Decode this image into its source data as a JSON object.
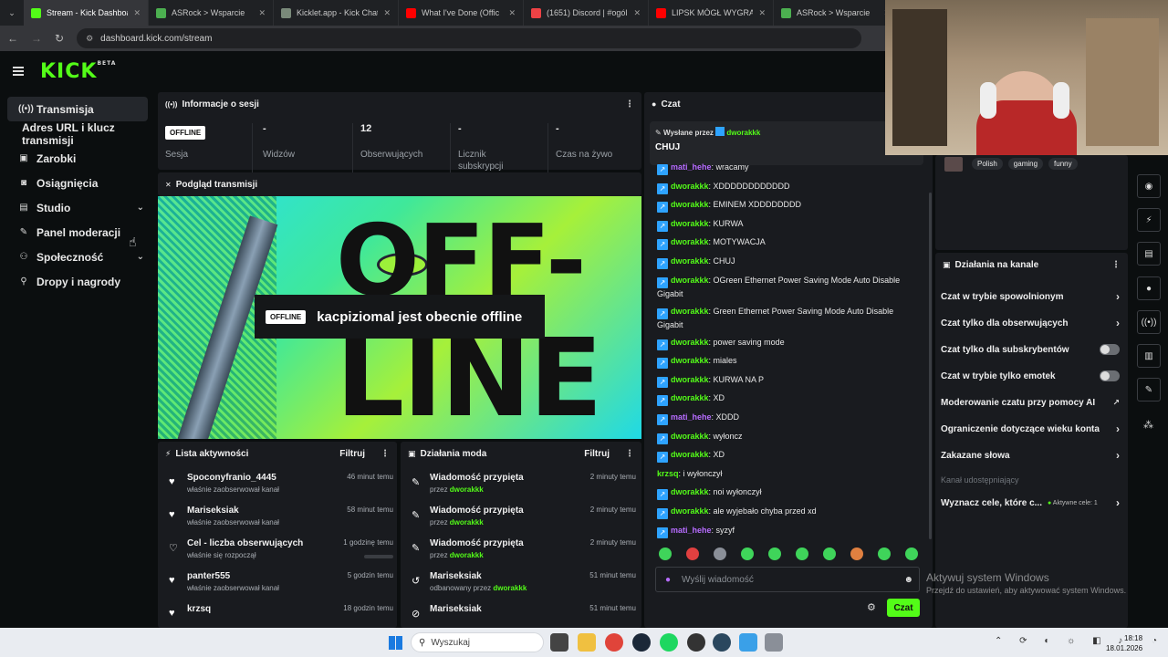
{
  "browser": {
    "tabs": [
      {
        "title": "Stream - Kick Dashboard",
        "color": "#53fc18",
        "active": true
      },
      {
        "title": "ASRock > Wsparcie",
        "color": "#4caf50"
      },
      {
        "title": "Kicklet.app - Kick Chatbot",
        "color": "#7a8a7a"
      },
      {
        "title": "What I've Done (Offic",
        "color": "#ff0000"
      },
      {
        "title": "(1651) Discord | #ogólny",
        "color": "#ed4245"
      },
      {
        "title": "LIPSK MÓGŁ WYGRAĆ, A",
        "color": "#ff0000"
      },
      {
        "title": "ASRock > Wsparcie",
        "color": "#4caf50"
      }
    ],
    "url": "dashboard.kick.com/stream"
  },
  "header": {
    "logo": "KICK",
    "beta": "BETA"
  },
  "sidebar": {
    "items": [
      {
        "label": "Transmisja",
        "icon": "broadcast-icon"
      },
      {
        "label": "Adres URL i klucz transmisji",
        "icon": ""
      },
      {
        "label": "Zarobki",
        "icon": "wallet-icon"
      },
      {
        "label": "Osiągnięcia",
        "icon": "trophy-icon"
      },
      {
        "label": "Studio",
        "icon": "studio-icon"
      },
      {
        "label": "Panel moderacji",
        "icon": "wrench-icon"
      },
      {
        "label": "Społeczność",
        "icon": "people-icon"
      },
      {
        "label": "Dropy i nagrody",
        "icon": "gift-icon"
      }
    ]
  },
  "session": {
    "title": "Informacje o sesji",
    "status": "OFFLINE",
    "status_label": "Sesja",
    "stats": [
      {
        "value": "-",
        "label": "Widzów"
      },
      {
        "value": "12",
        "label": "Obserwujących"
      },
      {
        "value": "-",
        "label": "Licznik subskrypcji"
      },
      {
        "value": "-",
        "label": "Czas na żywo"
      }
    ]
  },
  "preview": {
    "title": "Podgląd transmisji",
    "badge": "OFFLINE",
    "message": "kacpiziomal jest obecnie offline",
    "bg_text_1": "OFF-",
    "bg_text_2": "LINE"
  },
  "activity": {
    "title": "Lista aktywności",
    "filter": "Filtruj",
    "rows": [
      {
        "name": "Spoconyfranio_4445",
        "sub": "właśnie zaobserwował kanał",
        "time": "46 minut temu"
      },
      {
        "name": "Mariseksiak",
        "sub": "właśnie zaobserwował kanał",
        "time": "58 minut temu"
      },
      {
        "name": "Cel - liczba obserwujących",
        "sub": "właśnie się rozpoczął",
        "time": "1 godzinę temu"
      },
      {
        "name": "panter555",
        "sub": "właśnie zaobserwował kanał",
        "time": "5 godzin temu"
      },
      {
        "name": "krzsq",
        "sub": "",
        "time": "18 godzin temu"
      }
    ]
  },
  "modactions": {
    "title": "Działania moda",
    "filter": "Filtruj",
    "rows": [
      {
        "name": "Wiadomość przypięta",
        "sub_prefix": "przez",
        "by": "dworakkk",
        "time": "2 minuty temu"
      },
      {
        "name": "Wiadomość przypięta",
        "sub_prefix": "przez",
        "by": "dworakkk",
        "time": "2 minuty temu"
      },
      {
        "name": "Wiadomość przypięta",
        "sub_prefix": "przez",
        "by": "dworakkk",
        "time": "2 minuty temu"
      },
      {
        "name": "Mariseksiak",
        "sub_prefix": "odbanowany przez",
        "by": "dworakkk",
        "time": "51 minut temu"
      },
      {
        "name": "Mariseksiak",
        "sub_prefix": "",
        "by": "",
        "time": "51 minut temu"
      }
    ]
  },
  "chat": {
    "title": "Czat",
    "pinned_label": "Wysłane przez",
    "pinned_user": "dworakkk",
    "pinned_text": "CHUJ",
    "messages": [
      {
        "user": "mati_hehe",
        "text": "wracamy",
        "purple": true
      },
      {
        "user": "dworakkk",
        "text": "XDDDDDDDDDDDD"
      },
      {
        "user": "dworakkk",
        "text": "EMINEM XDDDDDDDD"
      },
      {
        "user": "dworakkk",
        "text": "KURWA"
      },
      {
        "user": "dworakkk",
        "text": "MOTYWACJA"
      },
      {
        "user": "dworakkk",
        "text": "CHUJ"
      },
      {
        "user": "dworakkk",
        "text": "OGreen Ethernet Power Saving Mode Auto Disable Gigabit"
      },
      {
        "user": "dworakkk",
        "text": "Green Ethernet Power Saving Mode Auto Disable Gigabit"
      },
      {
        "user": "dworakkk",
        "text": "power saving mode"
      },
      {
        "user": "dworakkk",
        "text": "miales"
      },
      {
        "user": "dworakkk",
        "text": "KURWA NA P"
      },
      {
        "user": "dworakkk",
        "text": "XD"
      },
      {
        "user": "mati_hehe",
        "text": "XDDD",
        "purple": true
      },
      {
        "user": "dworakkk",
        "text": "wyłoncz"
      },
      {
        "user": "dworakkk",
        "text": "XD"
      },
      {
        "user": "krzsq",
        "text": "i wyłonczył",
        "noava": true
      },
      {
        "user": "dworakkk",
        "text": "noi wyłonczył"
      },
      {
        "user": "dworakkk",
        "text": "ale wyjebało chyba przed xd"
      },
      {
        "user": "mati_hehe",
        "text": "syzyf",
        "purple": true
      }
    ],
    "input_placeholder": "Wyślij wiadomość",
    "send": "Czat"
  },
  "tags": [
    "Polish",
    "gaming",
    "funny"
  ],
  "channel": {
    "title": "Działania na kanale",
    "items": [
      {
        "label": "Czat w trybie spowolnionym",
        "kind": "arrow"
      },
      {
        "label": "Czat tylko dla obserwujących",
        "kind": "arrow"
      },
      {
        "label": "Czat tylko dla subskrybentów",
        "kind": "toggle"
      },
      {
        "label": "Czat w trybie tylko emotek",
        "kind": "toggle"
      },
      {
        "label": "Moderowanie czatu przy pomocy AI",
        "kind": "ext"
      },
      {
        "label": "Ograniczenie dotyczące wieku konta",
        "kind": "arrow"
      },
      {
        "label": "Zakazane słowa",
        "kind": "arrow"
      }
    ],
    "shared": "Kanał udostępniający",
    "goals": "Wyznacz cele, które c...",
    "goals_badge": "Aktywne cele: 1"
  },
  "watermark": {
    "line1": "Aktywuj system Windows",
    "line2": "Przejdź do ustawień, aby aktywować system Windows."
  },
  "taskbar": {
    "search": "Wyszukaj",
    "time": "18:18",
    "date": "18.01.2026"
  }
}
